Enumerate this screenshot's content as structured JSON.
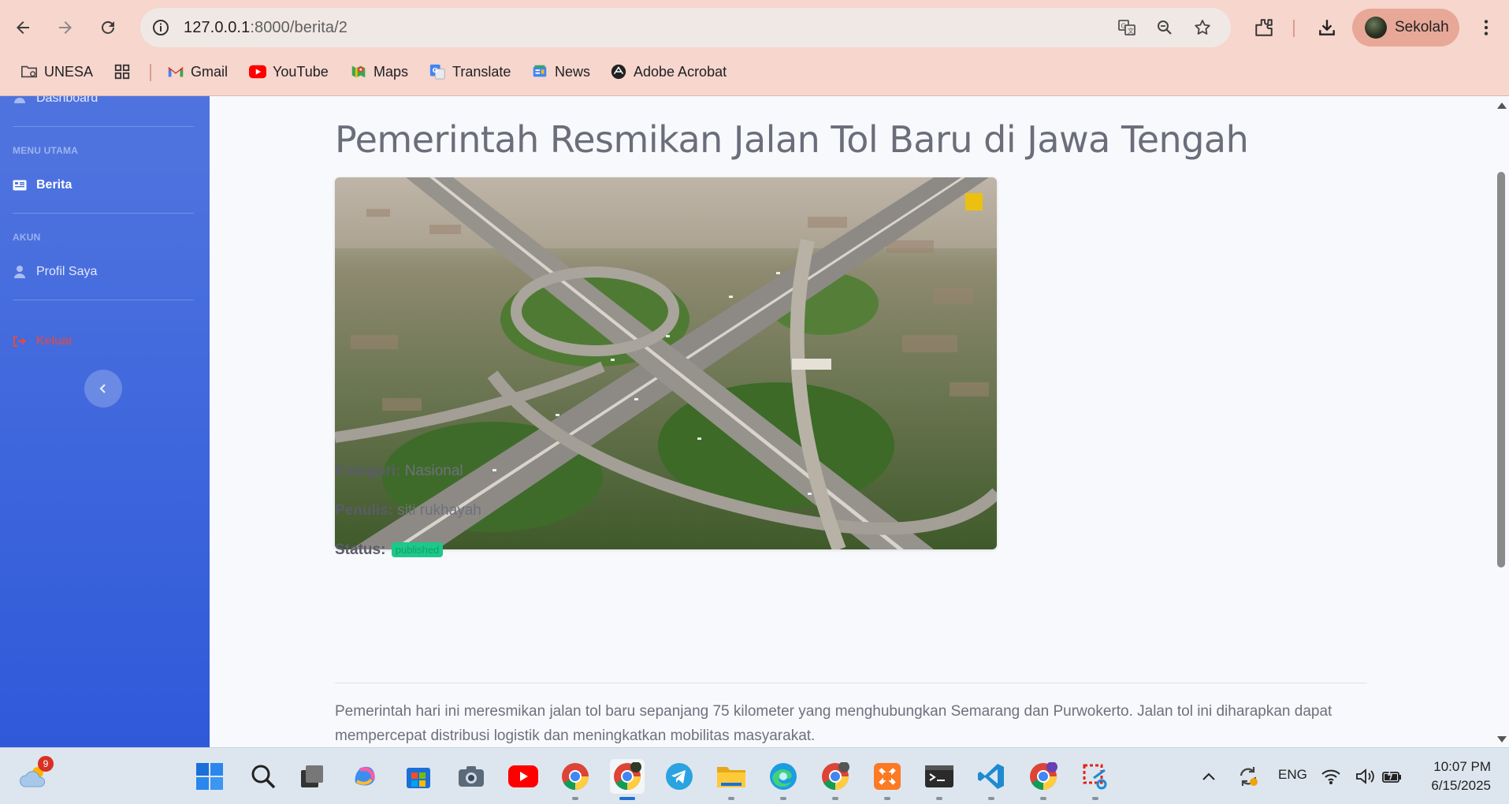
{
  "browser": {
    "url_host": "127.0.0.1",
    "url_rest": ":8000/berita/2",
    "profile_name": "Sekolah",
    "bookmarks": [
      {
        "label": "UNESA",
        "icon": "folder-gear-icon"
      },
      {
        "label": "",
        "icon": "apps-grid-icon"
      },
      {
        "label": "Gmail",
        "icon": "gmail-icon"
      },
      {
        "label": "YouTube",
        "icon": "youtube-icon"
      },
      {
        "label": "Maps",
        "icon": "maps-icon"
      },
      {
        "label": "Translate",
        "icon": "translate-icon"
      },
      {
        "label": "News",
        "icon": "news-icon"
      },
      {
        "label": "Adobe Acrobat",
        "icon": "acrobat-icon"
      }
    ]
  },
  "sidebar": {
    "dashboard_label": "Dashboard",
    "heading_main": "MENU UTAMA",
    "berita_label": "Berita",
    "heading_account": "AKUN",
    "profile_label": "Profil Saya",
    "logout_label": "Keluar"
  },
  "article": {
    "title": "Pemerintah Resmikan Jalan Tol Baru di Jawa Tengah",
    "image_alt": "aerial highway interchange photo",
    "category_label": "Kategori:",
    "category_value": "Nasional",
    "author_label": "Penulis:",
    "author_value": "siti rukhayah",
    "status_label": "Status:",
    "status_value": "published",
    "body": "Pemerintah hari ini meresmikan jalan tol baru sepanjang 75 kilometer yang menghubungkan Semarang dan Purwokerto. Jalan tol ini diharapkan dapat mempercepat distribusi logistik dan meningkatkan mobilitas masyarakat."
  },
  "taskbar": {
    "weather_badge": "9",
    "language": "ENG",
    "time": "10:07 PM",
    "date": "6/15/2025"
  },
  "colors": {
    "sidebar_top": "#4e73df",
    "sidebar_bottom": "#2e59d9",
    "badge_green": "#1cc88a",
    "logout_red": "#e74a3b",
    "chrome_bg": "#f6d6cd"
  }
}
